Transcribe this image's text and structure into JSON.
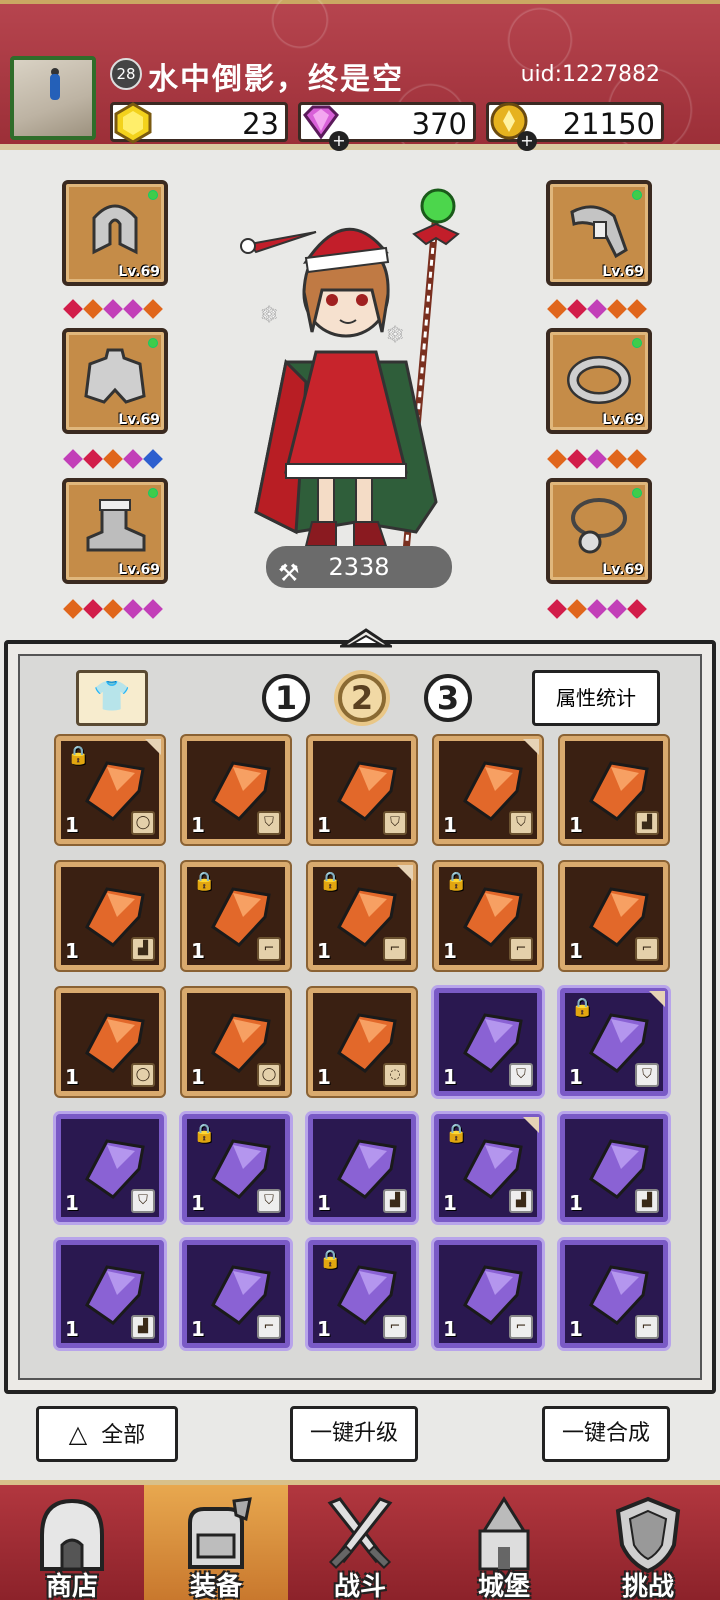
{
  "player": {
    "name": "水中倒影，终是空",
    "level": "28",
    "uid": "uid:1227882"
  },
  "resources": [
    {
      "icon": "yellow-gem-icon",
      "value": "23"
    },
    {
      "icon": "purple-diamond-icon",
      "value": "370"
    },
    {
      "icon": "gold-coin-icon",
      "value": "21150"
    }
  ],
  "equipment": {
    "left": [
      {
        "name": "hood",
        "level": "Lv.69"
      },
      {
        "name": "cape",
        "level": "Lv.69"
      },
      {
        "name": "boot",
        "level": "Lv.69"
      }
    ],
    "right": [
      {
        "name": "bracer",
        "level": "Lv.69"
      },
      {
        "name": "ring",
        "level": "Lv.69"
      },
      {
        "name": "necklace",
        "level": "Lv.69"
      }
    ]
  },
  "power": "2338",
  "tabs": {
    "pages": [
      "1",
      "2",
      "3"
    ],
    "active_page": "2",
    "stat_button": "属性统计"
  },
  "inventory": [
    {
      "rarity": "orange",
      "qty": "1",
      "lock": true,
      "corner": true,
      "type": "ring"
    },
    {
      "rarity": "orange",
      "qty": "1",
      "lock": false,
      "corner": false,
      "type": "cape"
    },
    {
      "rarity": "orange",
      "qty": "1",
      "lock": false,
      "corner": false,
      "type": "cape"
    },
    {
      "rarity": "orange",
      "qty": "1",
      "lock": false,
      "corner": true,
      "type": "cape"
    },
    {
      "rarity": "orange",
      "qty": "1",
      "lock": false,
      "corner": false,
      "type": "boot"
    },
    {
      "rarity": "orange",
      "qty": "1",
      "lock": false,
      "corner": false,
      "type": "boot"
    },
    {
      "rarity": "orange",
      "qty": "1",
      "lock": true,
      "corner": false,
      "type": "bracer"
    },
    {
      "rarity": "orange",
      "qty": "1",
      "lock": true,
      "corner": true,
      "type": "bracer"
    },
    {
      "rarity": "orange",
      "qty": "1",
      "lock": true,
      "corner": false,
      "type": "bracer"
    },
    {
      "rarity": "orange",
      "qty": "1",
      "lock": false,
      "corner": false,
      "type": "bracer"
    },
    {
      "rarity": "orange",
      "qty": "1",
      "lock": false,
      "corner": false,
      "type": "ring"
    },
    {
      "rarity": "orange",
      "qty": "1",
      "lock": false,
      "corner": false,
      "type": "ring"
    },
    {
      "rarity": "orange",
      "qty": "1",
      "lock": false,
      "corner": false,
      "type": "necklace"
    },
    {
      "rarity": "purple",
      "qty": "1",
      "lock": false,
      "corner": false,
      "type": "cape"
    },
    {
      "rarity": "purple",
      "qty": "1",
      "lock": true,
      "corner": true,
      "type": "cape"
    },
    {
      "rarity": "purple",
      "qty": "1",
      "lock": false,
      "corner": false,
      "type": "cape"
    },
    {
      "rarity": "purple",
      "qty": "1",
      "lock": true,
      "corner": false,
      "type": "cape"
    },
    {
      "rarity": "purple",
      "qty": "1",
      "lock": false,
      "corner": false,
      "type": "boot"
    },
    {
      "rarity": "purple",
      "qty": "1",
      "lock": true,
      "corner": true,
      "type": "boot"
    },
    {
      "rarity": "purple",
      "qty": "1",
      "lock": false,
      "corner": false,
      "type": "boot"
    },
    {
      "rarity": "purple",
      "qty": "1",
      "lock": false,
      "corner": false,
      "type": "boot"
    },
    {
      "rarity": "purple",
      "qty": "1",
      "lock": false,
      "corner": false,
      "type": "bracer"
    },
    {
      "rarity": "purple",
      "qty": "1",
      "lock": true,
      "corner": false,
      "type": "bracer"
    },
    {
      "rarity": "purple",
      "qty": "1",
      "lock": false,
      "corner": false,
      "type": "bracer"
    },
    {
      "rarity": "purple",
      "qty": "1",
      "lock": false,
      "corner": false,
      "type": "bracer"
    }
  ],
  "actions": {
    "all": "全部",
    "upgrade_all": "一键升级",
    "merge_all": "一键合成"
  },
  "nav": [
    {
      "label": "商店",
      "icon": "shop-icon"
    },
    {
      "label": "装备",
      "icon": "backpack-icon",
      "active": true
    },
    {
      "label": "战斗",
      "icon": "swords-icon"
    },
    {
      "label": "城堡",
      "icon": "castle-icon"
    },
    {
      "label": "挑战",
      "icon": "shield-icon"
    }
  ],
  "colors": {
    "header": "#9c2f38",
    "orange_item": "#d9aa6e",
    "purple_item": "#7a5ac6",
    "gem_red": "#d21d4a",
    "gem_orange": "#e0661c",
    "gem_purple": "#c23fb8",
    "gem_blue": "#2d5fcf"
  }
}
